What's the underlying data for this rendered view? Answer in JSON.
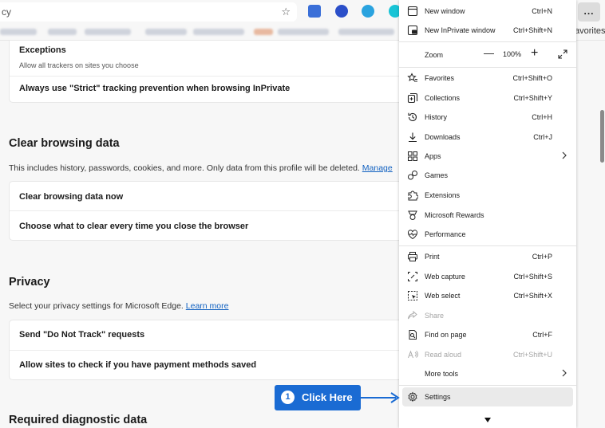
{
  "toolbar": {
    "address_text": "cy",
    "more_label": "..."
  },
  "favorites_bar": {
    "tail_label": "avorites"
  },
  "tracking": {
    "exceptions_title": "Exceptions",
    "exceptions_desc": "Allow all trackers on sites you choose",
    "strict_inprivate": "Always use \"Strict\" tracking prevention when browsing InPrivate"
  },
  "clear_data": {
    "title": "Clear browsing data",
    "desc": "This includes history, passwords, cookies, and more. Only data from this profile will be deleted.",
    "manage_link": "Manage",
    "now": "Clear browsing data now",
    "choose": "Choose what to clear every time you close the browser"
  },
  "privacy": {
    "title": "Privacy",
    "desc": "Select your privacy settings for Microsoft Edge.",
    "learn_more": "Learn more",
    "dnt": "Send \"Do Not Track\" requests",
    "payment": "Allow sites to check if you have payment methods saved"
  },
  "diagnostic": {
    "title": "Required diagnostic data"
  },
  "menu": {
    "new_window": {
      "label": "New window",
      "shortcut": "Ctrl+N"
    },
    "new_inprivate": {
      "label": "New InPrivate window",
      "shortcut": "Ctrl+Shift+N"
    },
    "zoom": {
      "label": "Zoom",
      "minus": "—",
      "value": "100%",
      "plus": "+"
    },
    "favorites": {
      "label": "Favorites",
      "shortcut": "Ctrl+Shift+O"
    },
    "collections": {
      "label": "Collections",
      "shortcut": "Ctrl+Shift+Y"
    },
    "history": {
      "label": "History",
      "shortcut": "Ctrl+H"
    },
    "downloads": {
      "label": "Downloads",
      "shortcut": "Ctrl+J"
    },
    "apps": {
      "label": "Apps"
    },
    "games": {
      "label": "Games"
    },
    "extensions": {
      "label": "Extensions"
    },
    "rewards": {
      "label": "Microsoft Rewards"
    },
    "performance": {
      "label": "Performance"
    },
    "print": {
      "label": "Print",
      "shortcut": "Ctrl+P"
    },
    "web_capture": {
      "label": "Web capture",
      "shortcut": "Ctrl+Shift+S"
    },
    "web_select": {
      "label": "Web select",
      "shortcut": "Ctrl+Shift+X"
    },
    "share": {
      "label": "Share"
    },
    "find": {
      "label": "Find on page",
      "shortcut": "Ctrl+F"
    },
    "read_aloud": {
      "label": "Read aloud",
      "shortcut": "Ctrl+Shift+U"
    },
    "more_tools": {
      "label": "More tools"
    },
    "settings": {
      "label": "Settings"
    }
  },
  "callout": {
    "number": "1",
    "text": "Click Here"
  },
  "colors": {
    "accent": "#1a6bd3",
    "link": "#1060c0"
  }
}
